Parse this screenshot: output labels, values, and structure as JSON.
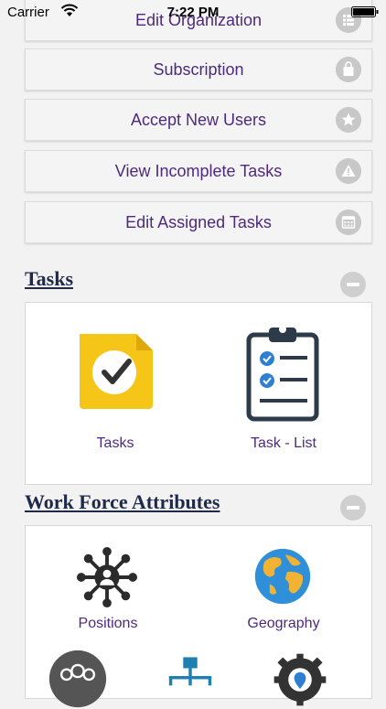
{
  "status_bar": {
    "carrier": "Carrier",
    "time": "7:22 PM"
  },
  "menu": {
    "items": [
      {
        "label": "Edit Organization",
        "icon": "list-icon"
      },
      {
        "label": "Subscription",
        "icon": "shopping-bag-icon"
      },
      {
        "label": "Accept New Users",
        "icon": "star-icon"
      },
      {
        "label": "View Incomplete Tasks",
        "icon": "warning-icon"
      },
      {
        "label": "Edit Assigned Tasks",
        "icon": "calendar-icon"
      }
    ]
  },
  "tasks_section": {
    "title": "Tasks",
    "tiles": [
      {
        "label": "Tasks",
        "icon": "task-check-icon"
      },
      {
        "label": "Task - List",
        "icon": "clipboard-list-icon"
      }
    ]
  },
  "workforce_section": {
    "title": "Work Force Attributes",
    "tiles": [
      {
        "label": "Positions",
        "icon": "network-person-icon"
      },
      {
        "label": "Geography",
        "icon": "globe-icon"
      }
    ]
  },
  "colors": {
    "label_purple": "#4d2a7e",
    "title_navy": "#1f2a4a",
    "task_yellow": "#f5c518",
    "check_blue": "#2f7fd1"
  }
}
